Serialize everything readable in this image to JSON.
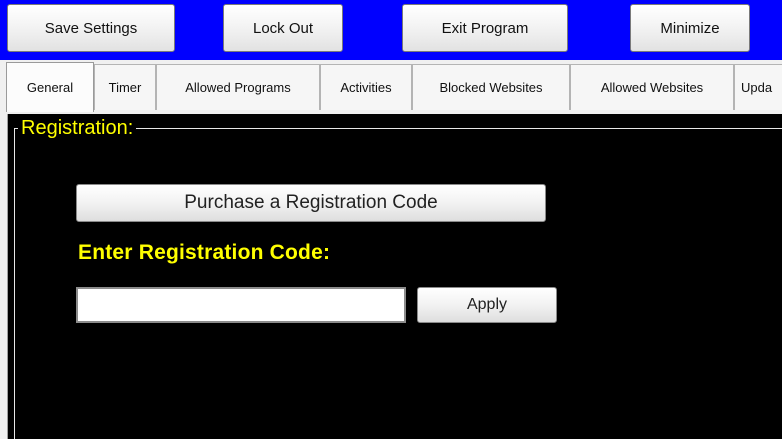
{
  "toolbar": {
    "save_label": "Save Settings",
    "lockout_label": "Lock Out",
    "exit_label": "Exit Program",
    "minimize_label": "Minimize",
    "background_color": "#0000ff"
  },
  "tabs": [
    {
      "label": "General"
    },
    {
      "label": "Timer"
    },
    {
      "label": "Allowed Programs"
    },
    {
      "label": "Activities"
    },
    {
      "label": "Blocked Websites"
    },
    {
      "label": "Allowed Websites"
    },
    {
      "label": "Upda"
    }
  ],
  "registration": {
    "group_title": "Registration:",
    "purchase_label": "Purchase a Registration Code",
    "code_label": "Enter Registration Code:",
    "code_value": "",
    "apply_label": "Apply",
    "label_color": "#ffff00",
    "panel_color": "#000000"
  }
}
